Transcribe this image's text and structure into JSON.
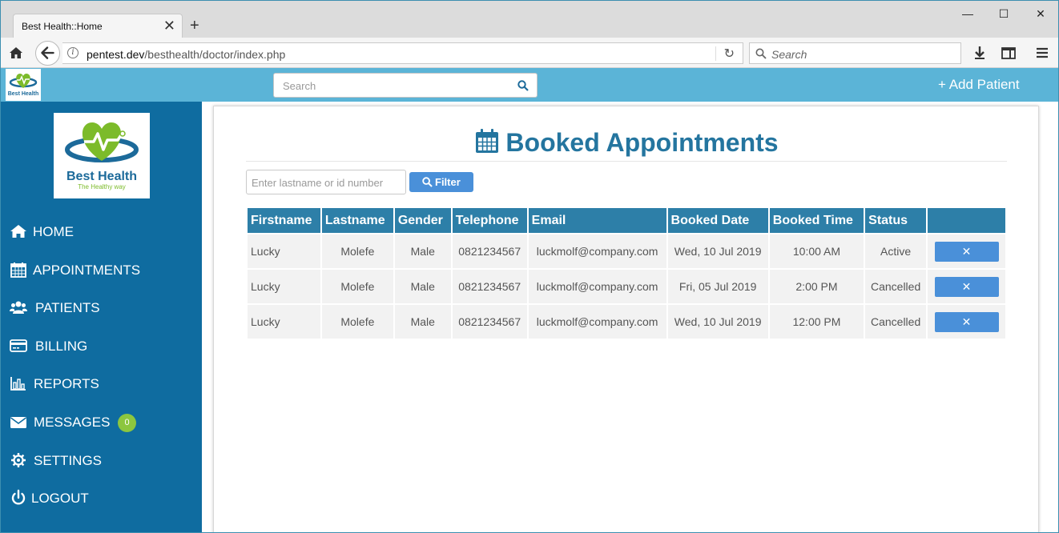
{
  "browser": {
    "tab_title": "Best Health::Home",
    "tab_close": "✕",
    "new_tab": "+",
    "window_controls": {
      "minimize": "—",
      "maximize": "☐",
      "close": "✕"
    },
    "url_host": "pentest.dev",
    "url_path": "/besthealth/doctor/index.php",
    "url_info": "i",
    "reload": "↻",
    "search_placeholder": "Search"
  },
  "app": {
    "search_placeholder": "Search",
    "add_patient": "+ Add Patient",
    "logo_name": "Best Health",
    "logo_tagline": "The Healthy way"
  },
  "sidebar": {
    "items": [
      {
        "label": "HOME",
        "icon": "home-icon"
      },
      {
        "label": "APPOINTMENTS",
        "icon": "calendar-icon"
      },
      {
        "label": "PATIENTS",
        "icon": "users-icon"
      },
      {
        "label": "BILLING",
        "icon": "credit-card-icon"
      },
      {
        "label": "REPORTS",
        "icon": "bar-chart-icon"
      },
      {
        "label": "MESSAGES",
        "icon": "envelope-icon",
        "badge": "0"
      },
      {
        "label": "SETTINGS",
        "icon": "gear-icon"
      },
      {
        "label": "LOGOUT",
        "icon": "power-icon"
      }
    ]
  },
  "main": {
    "title": "Booked Appointments",
    "filter_placeholder": "Enter lastname or id number",
    "filter_button": "Filter",
    "columns": [
      "Firstname",
      "Lastname",
      "Gender",
      "Telephone",
      "Email",
      "Booked Date",
      "Booked Time",
      "Status",
      ""
    ],
    "rows": [
      [
        "Lucky",
        "Molefe",
        "Male",
        "0821234567",
        "luckmolf@company.com",
        "Wed, 10 Jul 2019",
        "10:00 AM",
        "Active"
      ],
      [
        "Lucky",
        "Molefe",
        "Male",
        "0821234567",
        "luckmolf@company.com",
        "Fri, 05 Jul 2019",
        "2:00 PM",
        "Cancelled"
      ],
      [
        "Lucky",
        "Molefe",
        "Male",
        "0821234567",
        "luckmolf@company.com",
        "Wed, 10 Jul 2019",
        "12:00 PM",
        "Cancelled"
      ]
    ],
    "delete_label": "✕"
  },
  "colors": {
    "app_header": "#5bb4d7",
    "sidebar": "#0f6ca0",
    "table_header": "#2d7fa8",
    "button": "#4a90d9",
    "badge": "#8cc63f",
    "title": "#24759f"
  }
}
